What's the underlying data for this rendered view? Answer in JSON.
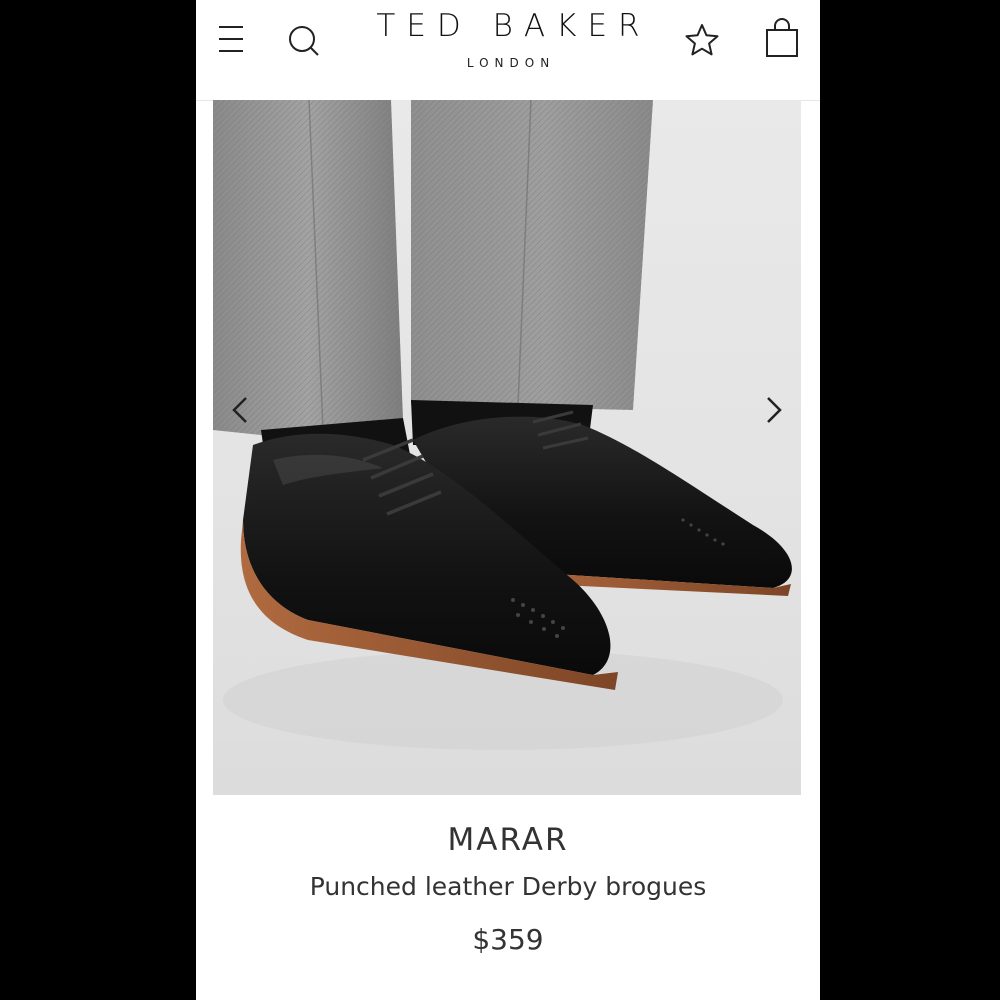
{
  "header": {
    "brand": "TED BAKER",
    "brand_sub": "LONDON",
    "icons": {
      "menu": "menu-icon",
      "search": "search-icon",
      "wishlist": "star-icon",
      "bag": "shopping-bag-icon"
    }
  },
  "gallery": {
    "image_subject": "product-photo",
    "prev_icon": "chevron-left-icon",
    "next_icon": "chevron-right-icon"
  },
  "product": {
    "name": "MARAR",
    "description": "Punched leather Derby brogues",
    "price": "$359"
  },
  "colors": {
    "background_outer": "#000000",
    "page_bg": "#ffffff",
    "text": "#333333",
    "trouser_grey": "#8f8f8f",
    "shoe_black": "#151515",
    "sole_brown": "#9a5a35"
  }
}
